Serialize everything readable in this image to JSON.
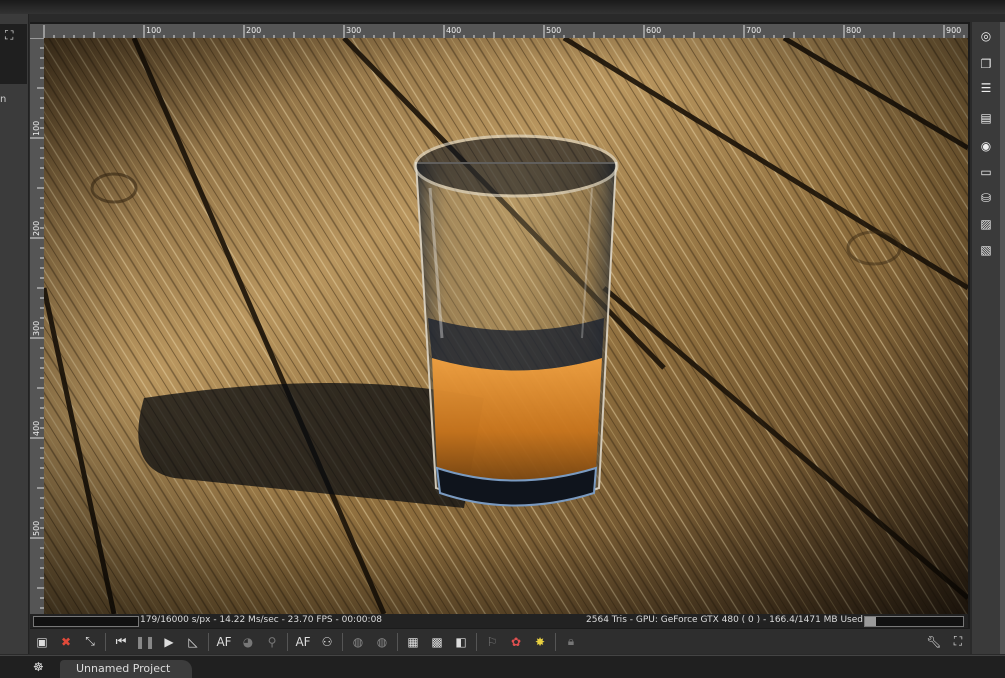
{
  "ruler": {
    "h_ticks": [
      "100",
      "200",
      "300",
      "400",
      "500",
      "600",
      "700",
      "800",
      "900"
    ],
    "v_ticks": [
      "100",
      "200",
      "300",
      "400",
      "500"
    ]
  },
  "status": {
    "left_text": "179/16000 s/px - 14.22 Ms/sec - 23.70 FPS - 00:00:08",
    "right_text": "2564 Tris - GPU: GeForce GTX 480 ( 0 ) - 166.4/1471 MB Used",
    "gpu_memory_fraction": 0.113
  },
  "toolbar": {
    "af_label": "AF",
    "af_label_2": "AF",
    "fullscreen_icon": "fullscreen-icon"
  },
  "left_panel": {
    "cut_text": "n"
  },
  "bottom": {
    "tab_label": "Unnamed Project"
  },
  "colors": {
    "app_bg": "#2a2a2a",
    "ruler_bg": "#555555",
    "wood_light": "#c9a873",
    "wood_dark": "#3a2a16",
    "liquid": "#d58a2a"
  }
}
